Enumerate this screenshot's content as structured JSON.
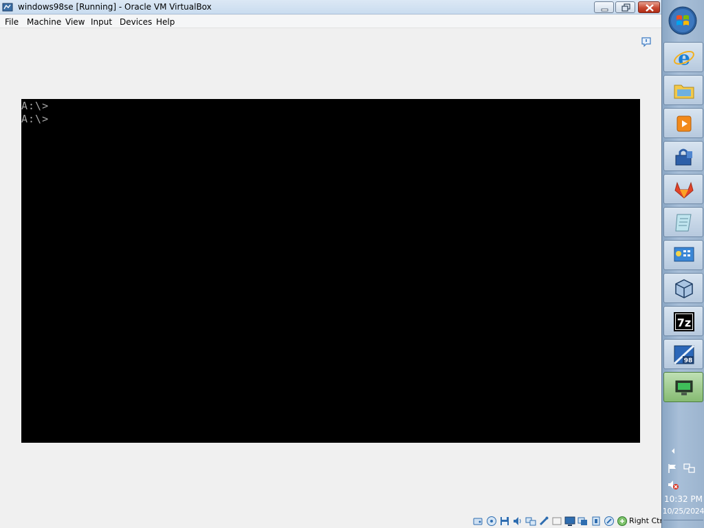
{
  "window": {
    "title": "windows98se [Running] - Oracle VM VirtualBox"
  },
  "menu": {
    "items": [
      {
        "label": "File"
      },
      {
        "label": "Machine"
      },
      {
        "label": "View"
      },
      {
        "label": "Input"
      },
      {
        "label": "Devices"
      },
      {
        "label": "Help"
      }
    ]
  },
  "guest": {
    "lines": [
      "A:\\>",
      "A:\\>"
    ]
  },
  "status_bar": {
    "host_key": "Right Ctrl",
    "icons": [
      "hard-disk-icon",
      "optical-drive-icon",
      "floppy-icon",
      "audio-icon",
      "network-adapter-icon",
      "usb-icon",
      "shared-folders-icon",
      "display-icon",
      "recording-icon",
      "cpu-icon",
      "mouse-integration-icon",
      "host-key-icon"
    ]
  },
  "taskbar": {
    "buttons": [
      {
        "name": "internet-explorer-icon"
      },
      {
        "name": "file-explorer-icon"
      },
      {
        "name": "media-player-icon"
      },
      {
        "name": "lock-app-icon"
      },
      {
        "name": "gitlab-icon"
      },
      {
        "name": "notepad-icon"
      },
      {
        "name": "control-panel-icon"
      },
      {
        "name": "virtualbox-icon"
      },
      {
        "name": "7zip-icon"
      },
      {
        "name": "windows98-icon"
      },
      {
        "name": "vm-window-icon",
        "active": true
      }
    ],
    "clock": {
      "time": "10:32 PM",
      "date": "10/25/2024"
    },
    "accent_active": "#86bb72"
  }
}
